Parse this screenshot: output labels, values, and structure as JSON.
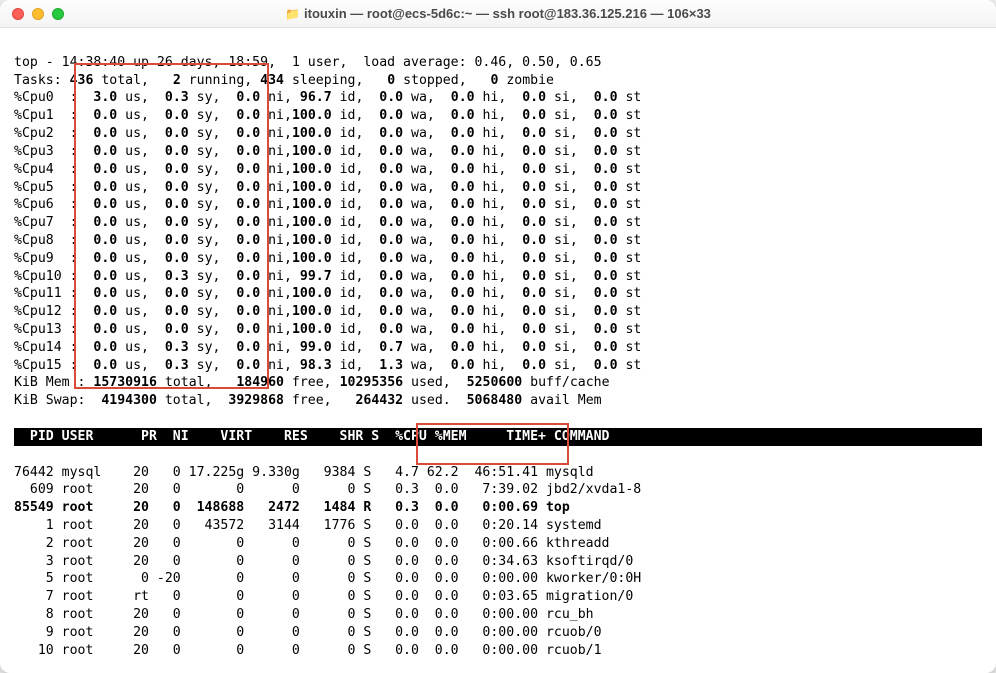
{
  "window": {
    "title": "itouxin — root@ecs-5d6c:~ — ssh root@183.36.125.216 — 106×33"
  },
  "top": {
    "line1": "top - 14:38:40 up 26 days, 18:59,  1 user,  load average: 0.46, 0.50, 0.65",
    "tasks": {
      "total": "436",
      "running": "2",
      "sleeping": "434",
      "stopped": "0",
      "zombie": "0"
    },
    "cpus": [
      {
        "n": "%Cpu0 ",
        "us": "3.0",
        "sy": "0.3",
        "ni": "0.0",
        "id": " 96.7",
        "wa": "0.0",
        "hi": "0.0",
        "si": "0.0",
        "st": "0.0"
      },
      {
        "n": "%Cpu1 ",
        "us": "0.0",
        "sy": "0.0",
        "ni": "0.0",
        "id": "100.0",
        "wa": "0.0",
        "hi": "0.0",
        "si": "0.0",
        "st": "0.0"
      },
      {
        "n": "%Cpu2 ",
        "us": "0.0",
        "sy": "0.0",
        "ni": "0.0",
        "id": "100.0",
        "wa": "0.0",
        "hi": "0.0",
        "si": "0.0",
        "st": "0.0"
      },
      {
        "n": "%Cpu3 ",
        "us": "0.0",
        "sy": "0.0",
        "ni": "0.0",
        "id": "100.0",
        "wa": "0.0",
        "hi": "0.0",
        "si": "0.0",
        "st": "0.0"
      },
      {
        "n": "%Cpu4 ",
        "us": "0.0",
        "sy": "0.0",
        "ni": "0.0",
        "id": "100.0",
        "wa": "0.0",
        "hi": "0.0",
        "si": "0.0",
        "st": "0.0"
      },
      {
        "n": "%Cpu5 ",
        "us": "0.0",
        "sy": "0.0",
        "ni": "0.0",
        "id": "100.0",
        "wa": "0.0",
        "hi": "0.0",
        "si": "0.0",
        "st": "0.0"
      },
      {
        "n": "%Cpu6 ",
        "us": "0.0",
        "sy": "0.0",
        "ni": "0.0",
        "id": "100.0",
        "wa": "0.0",
        "hi": "0.0",
        "si": "0.0",
        "st": "0.0"
      },
      {
        "n": "%Cpu7 ",
        "us": "0.0",
        "sy": "0.0",
        "ni": "0.0",
        "id": "100.0",
        "wa": "0.0",
        "hi": "0.0",
        "si": "0.0",
        "st": "0.0"
      },
      {
        "n": "%Cpu8 ",
        "us": "0.0",
        "sy": "0.0",
        "ni": "0.0",
        "id": "100.0",
        "wa": "0.0",
        "hi": "0.0",
        "si": "0.0",
        "st": "0.0"
      },
      {
        "n": "%Cpu9 ",
        "us": "0.0",
        "sy": "0.0",
        "ni": "0.0",
        "id": "100.0",
        "wa": "0.0",
        "hi": "0.0",
        "si": "0.0",
        "st": "0.0"
      },
      {
        "n": "%Cpu10",
        "us": "0.0",
        "sy": "0.3",
        "ni": "0.0",
        "id": " 99.7",
        "wa": "0.0",
        "hi": "0.0",
        "si": "0.0",
        "st": "0.0"
      },
      {
        "n": "%Cpu11",
        "us": "0.0",
        "sy": "0.0",
        "ni": "0.0",
        "id": "100.0",
        "wa": "0.0",
        "hi": "0.0",
        "si": "0.0",
        "st": "0.0"
      },
      {
        "n": "%Cpu12",
        "us": "0.0",
        "sy": "0.0",
        "ni": "0.0",
        "id": "100.0",
        "wa": "0.0",
        "hi": "0.0",
        "si": "0.0",
        "st": "0.0"
      },
      {
        "n": "%Cpu13",
        "us": "0.0",
        "sy": "0.0",
        "ni": "0.0",
        "id": "100.0",
        "wa": "0.0",
        "hi": "0.0",
        "si": "0.0",
        "st": "0.0"
      },
      {
        "n": "%Cpu14",
        "us": "0.0",
        "sy": "0.3",
        "ni": "0.0",
        "id": " 99.0",
        "wa": "0.7",
        "hi": "0.0",
        "si": "0.0",
        "st": "0.0"
      },
      {
        "n": "%Cpu15",
        "us": "0.0",
        "sy": "0.3",
        "ni": "0.0",
        "id": " 98.3",
        "wa": "1.3",
        "hi": "0.0",
        "si": "0.0",
        "st": "0.0"
      }
    ],
    "mem": {
      "total": "15730916",
      "free": "184960",
      "used": "10295356",
      "buff": "5250600"
    },
    "swap": {
      "total": "4194300",
      "free": "3929868",
      "used": "264432",
      "avail": "5068480"
    },
    "header": "  PID USER      PR  NI    VIRT    RES    SHR S  %CPU %MEM     TIME+ COMMAND                         ",
    "procs": [
      {
        "pid": "76442",
        "user": "mysql",
        "pr": "20",
        "ni": "0",
        "virt": "17.225g",
        "res": "9.330g",
        "shr": "9384",
        "s": "S",
        "cpu": "4.7",
        "mem": "62.2",
        "time": "46:51.41",
        "cmd": "mysqld",
        "bold": false
      },
      {
        "pid": "609",
        "user": "root",
        "pr": "20",
        "ni": "0",
        "virt": "0",
        "res": "0",
        "shr": "0",
        "s": "S",
        "cpu": "0.3",
        "mem": "0.0",
        "time": "7:39.02",
        "cmd": "jbd2/xvda1-8",
        "bold": false
      },
      {
        "pid": "85549",
        "user": "root",
        "pr": "20",
        "ni": "0",
        "virt": "148688",
        "res": "2472",
        "shr": "1484",
        "s": "R",
        "cpu": "0.3",
        "mem": "0.0",
        "time": "0:00.69",
        "cmd": "top",
        "bold": true
      },
      {
        "pid": "1",
        "user": "root",
        "pr": "20",
        "ni": "0",
        "virt": "43572",
        "res": "3144",
        "shr": "1776",
        "s": "S",
        "cpu": "0.0",
        "mem": "0.0",
        "time": "0:20.14",
        "cmd": "systemd",
        "bold": false
      },
      {
        "pid": "2",
        "user": "root",
        "pr": "20",
        "ni": "0",
        "virt": "0",
        "res": "0",
        "shr": "0",
        "s": "S",
        "cpu": "0.0",
        "mem": "0.0",
        "time": "0:00.66",
        "cmd": "kthreadd",
        "bold": false
      },
      {
        "pid": "3",
        "user": "root",
        "pr": "20",
        "ni": "0",
        "virt": "0",
        "res": "0",
        "shr": "0",
        "s": "S",
        "cpu": "0.0",
        "mem": "0.0",
        "time": "0:34.63",
        "cmd": "ksoftirqd/0",
        "bold": false
      },
      {
        "pid": "5",
        "user": "root",
        "pr": "0",
        "ni": "-20",
        "virt": "0",
        "res": "0",
        "shr": "0",
        "s": "S",
        "cpu": "0.0",
        "mem": "0.0",
        "time": "0:00.00",
        "cmd": "kworker/0:0H",
        "bold": false
      },
      {
        "pid": "7",
        "user": "root",
        "pr": "rt",
        "ni": "0",
        "virt": "0",
        "res": "0",
        "shr": "0",
        "s": "S",
        "cpu": "0.0",
        "mem": "0.0",
        "time": "0:03.65",
        "cmd": "migration/0",
        "bold": false
      },
      {
        "pid": "8",
        "user": "root",
        "pr": "20",
        "ni": "0",
        "virt": "0",
        "res": "0",
        "shr": "0",
        "s": "S",
        "cpu": "0.0",
        "mem": "0.0",
        "time": "0:00.00",
        "cmd": "rcu_bh",
        "bold": false
      },
      {
        "pid": "9",
        "user": "root",
        "pr": "20",
        "ni": "0",
        "virt": "0",
        "res": "0",
        "shr": "0",
        "s": "S",
        "cpu": "0.0",
        "mem": "0.0",
        "time": "0:00.00",
        "cmd": "rcuob/0",
        "bold": false
      },
      {
        "pid": "10",
        "user": "root",
        "pr": "20",
        "ni": "0",
        "virt": "0",
        "res": "0",
        "shr": "0",
        "s": "S",
        "cpu": "0.0",
        "mem": "0.0",
        "time": "0:00.00",
        "cmd": "rcuob/1",
        "bold": false
      }
    ]
  }
}
